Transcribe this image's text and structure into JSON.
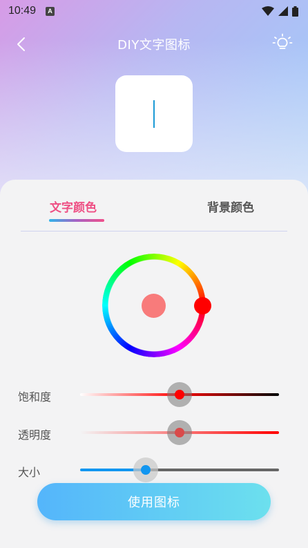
{
  "status_bar": {
    "time": "10:49",
    "notification_letter": "A"
  },
  "app_bar": {
    "title": "DIY文字图标"
  },
  "tabs": [
    {
      "label": "文字颜色",
      "active": true
    },
    {
      "label": "背景颜色",
      "active": false
    }
  ],
  "color_wheel": {
    "selected_color": "#ff0000",
    "preview_color": "#f87b7b"
  },
  "sliders": {
    "saturation": {
      "label": "饱和度",
      "value": 0.5
    },
    "opacity": {
      "label": "透明度",
      "value": 0.5
    },
    "size": {
      "label": "大小",
      "value": 0.33
    }
  },
  "primary_button": {
    "label": "使用图标"
  },
  "colors": {
    "accent_pink": "#ee4f84",
    "button_gradient_start": "#54b5fb",
    "button_gradient_end": "#6ce0ee",
    "preview_text": "#1a9ad6"
  },
  "icons": [
    "back-arrow-icon",
    "lightbulb-icon",
    "wifi-icon",
    "signal-icon",
    "battery-icon"
  ]
}
